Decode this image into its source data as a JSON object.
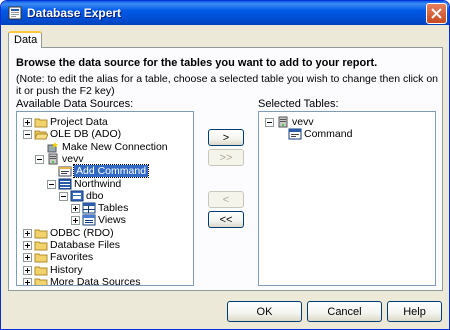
{
  "window": {
    "title": "Database Expert"
  },
  "tabs": [
    {
      "label": "Data"
    }
  ],
  "heading": "Browse the data source for the tables you want to add to your report.",
  "note": "(Note: to edit the alias for a table, choose a selected table you wish to change then click on it or push the F2 key)",
  "left_label": "Available Data Sources:",
  "right_label": "Selected Tables:",
  "available_tree": [
    {
      "label": "Project Data",
      "icon": "folder-icon",
      "expander": "plus"
    },
    {
      "label": "OLE DB (ADO)",
      "icon": "folder-open-icon",
      "expander": "minus"
    },
    {
      "label": "Make New Connection",
      "icon": "new-connection-icon",
      "expander": "none"
    },
    {
      "label": "vevv",
      "icon": "server-icon",
      "expander": "minus"
    },
    {
      "label": "Add Command",
      "icon": "command-icon",
      "expander": "none",
      "selected": true
    },
    {
      "label": "Northwind",
      "icon": "database-icon",
      "expander": "minus"
    },
    {
      "label": "dbo",
      "icon": "schema-icon",
      "expander": "minus"
    },
    {
      "label": "Tables",
      "icon": "table-folder-icon",
      "expander": "plus"
    },
    {
      "label": "Views",
      "icon": "view-folder-icon",
      "expander": "plus"
    },
    {
      "label": "ODBC (RDO)",
      "icon": "folder-icon",
      "expander": "plus"
    },
    {
      "label": "Database Files",
      "icon": "folder-icon",
      "expander": "plus"
    },
    {
      "label": "Favorites",
      "icon": "folder-icon",
      "expander": "plus"
    },
    {
      "label": "History",
      "icon": "folder-icon",
      "expander": "plus"
    },
    {
      "label": "More Data Sources",
      "icon": "folder-icon",
      "expander": "plus"
    }
  ],
  "selected_tree": [
    {
      "label": "vevv",
      "icon": "server-icon",
      "expander": "minus"
    },
    {
      "label": "Command",
      "icon": "command-table-icon",
      "expander": "none"
    }
  ],
  "transfer_buttons": [
    {
      "label": ">",
      "enabled": true
    },
    {
      "label": ">>",
      "enabled": false
    },
    {
      "label": "<",
      "enabled": false
    },
    {
      "label": "<<",
      "enabled": true
    }
  ],
  "footer_buttons": [
    {
      "label": "OK"
    },
    {
      "label": "Cancel"
    },
    {
      "label": "Help"
    }
  ],
  "colors": {
    "titlebar": "#0054e3",
    "selection": "#316ac5",
    "dialog_bg": "#ece9d8",
    "close_button": "#d85a32"
  }
}
